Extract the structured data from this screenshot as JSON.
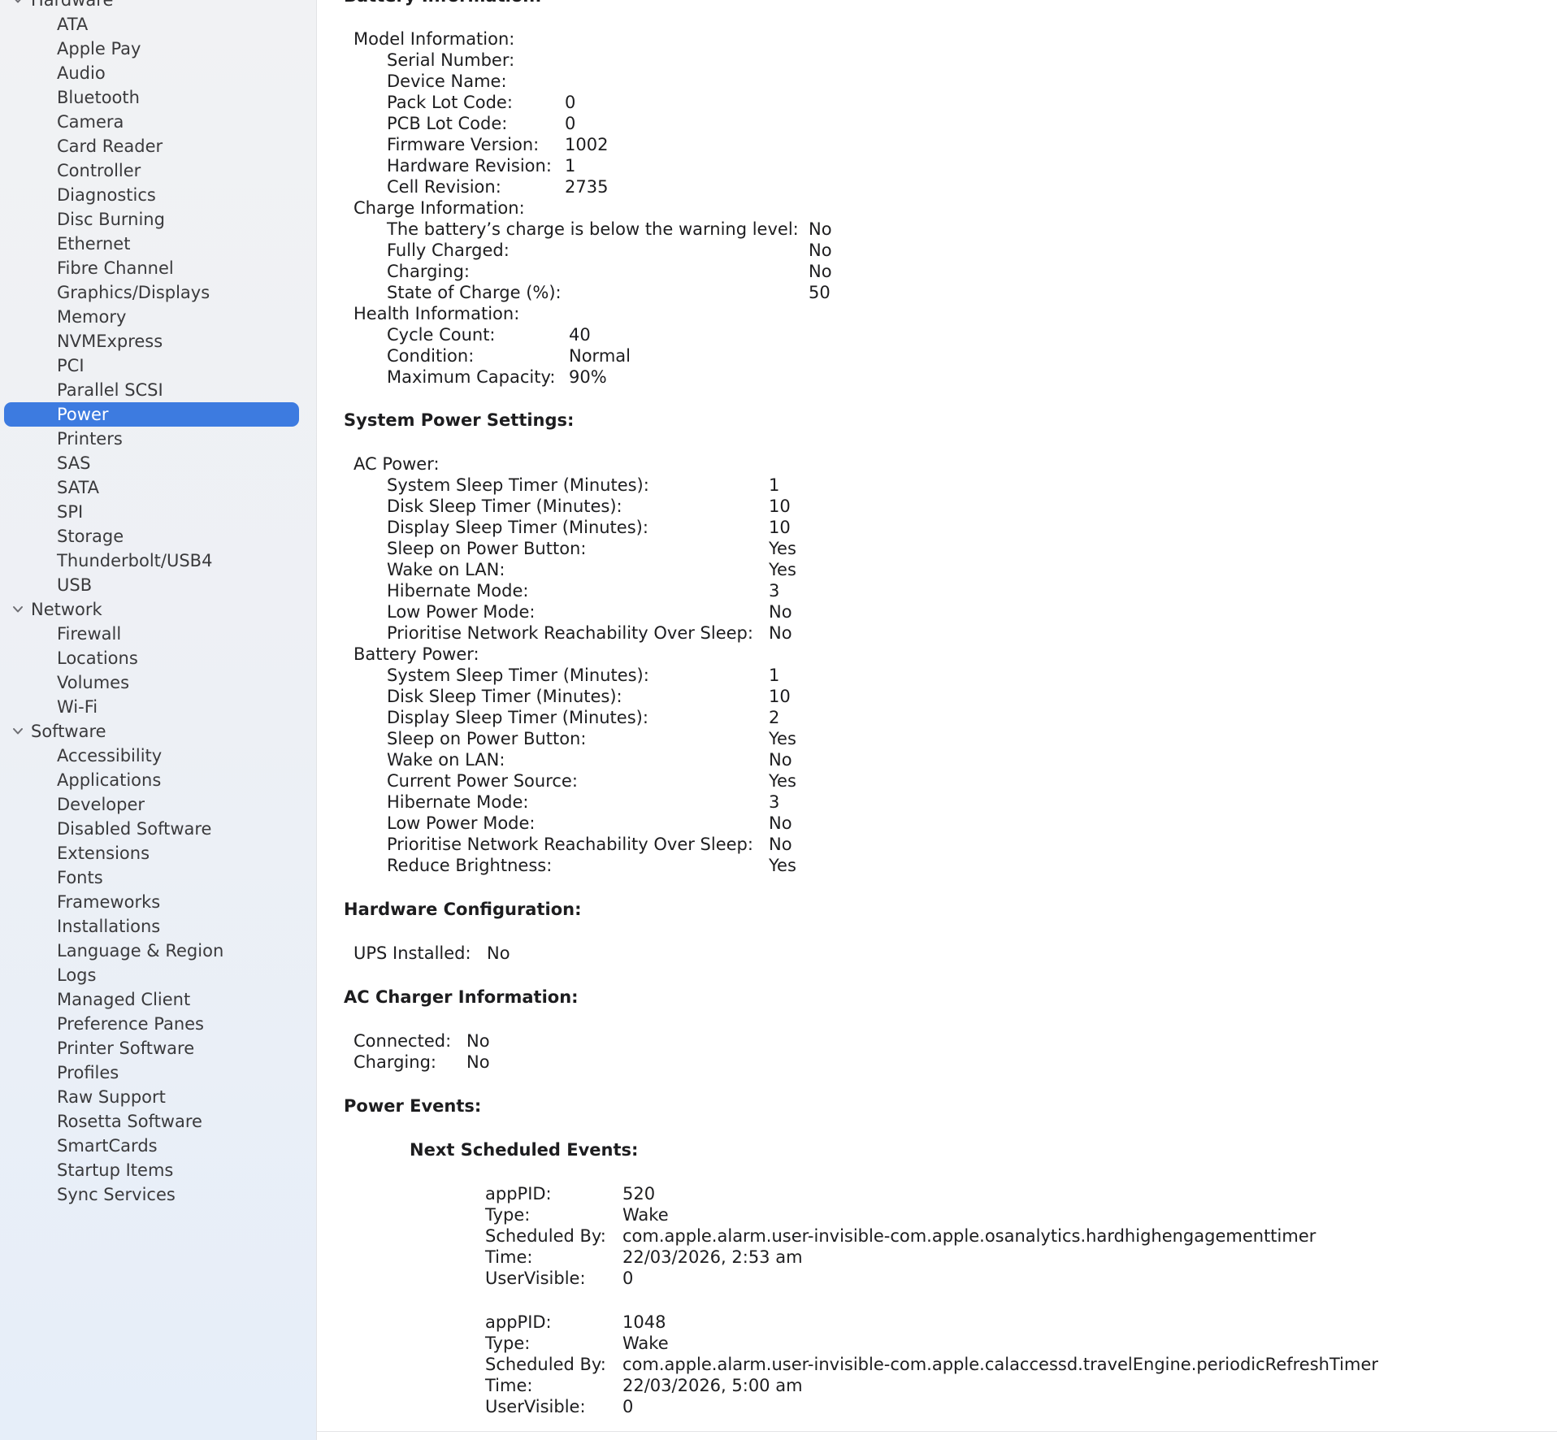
{
  "sidebar": {
    "groups": [
      {
        "label": "Hardware",
        "items": [
          "ATA",
          "Apple Pay",
          "Audio",
          "Bluetooth",
          "Camera",
          "Card Reader",
          "Controller",
          "Diagnostics",
          "Disc Burning",
          "Ethernet",
          "Fibre Channel",
          "Graphics/Displays",
          "Memory",
          "NVMExpress",
          "PCI",
          "Parallel SCSI",
          "Power",
          "Printers",
          "SAS",
          "SATA",
          "SPI",
          "Storage",
          "Thunderbolt/USB4",
          "USB"
        ]
      },
      {
        "label": "Network",
        "items": [
          "Firewall",
          "Locations",
          "Volumes",
          "Wi-Fi"
        ]
      },
      {
        "label": "Software",
        "items": [
          "Accessibility",
          "Applications",
          "Developer",
          "Disabled Software",
          "Extensions",
          "Fonts",
          "Frameworks",
          "Installations",
          "Language & Region",
          "Logs",
          "Managed Client",
          "Preference Panes",
          "Printer Software",
          "Profiles",
          "Raw Support",
          "Rosetta Software",
          "SmartCards",
          "Startup Items",
          "Sync Services"
        ]
      }
    ],
    "selected": "Power"
  },
  "content": {
    "battery_heading": "Battery Information:",
    "model_info_label": "Model Information:",
    "model_info": [
      {
        "label": "Serial Number:",
        "value": ""
      },
      {
        "label": "Device Name:",
        "value": ""
      },
      {
        "label": "Pack Lot Code:",
        "value": "0"
      },
      {
        "label": "PCB Lot Code:",
        "value": "0"
      },
      {
        "label": "Firmware Version:",
        "value": "1002"
      },
      {
        "label": "Hardware Revision:",
        "value": "1"
      },
      {
        "label": "Cell Revision:",
        "value": "2735"
      }
    ],
    "charge_info_label": "Charge Information:",
    "charge_info": [
      {
        "label": "The battery’s charge is below the warning level:",
        "value": "No"
      },
      {
        "label": "Fully Charged:",
        "value": "No"
      },
      {
        "label": "Charging:",
        "value": "No"
      },
      {
        "label": "State of Charge (%):",
        "value": "50"
      }
    ],
    "health_info_label": "Health Information:",
    "health_info": [
      {
        "label": "Cycle Count:",
        "value": "40"
      },
      {
        "label": "Condition:",
        "value": "Normal"
      },
      {
        "label": "Maximum Capacity:",
        "value": "90%"
      }
    ],
    "power_settings_heading": "System Power Settings:",
    "ac_power_label": "AC Power:",
    "ac_power": [
      {
        "label": "System Sleep Timer (Minutes):",
        "value": "1"
      },
      {
        "label": "Disk Sleep Timer (Minutes):",
        "value": "10"
      },
      {
        "label": "Display Sleep Timer (Minutes):",
        "value": "10"
      },
      {
        "label": "Sleep on Power Button:",
        "value": "Yes"
      },
      {
        "label": "Wake on LAN:",
        "value": "Yes"
      },
      {
        "label": "Hibernate Mode:",
        "value": "3"
      },
      {
        "label": "Low Power Mode:",
        "value": "No"
      },
      {
        "label": "Prioritise Network Reachability Over Sleep:",
        "value": "No"
      }
    ],
    "battery_power_label": "Battery Power:",
    "battery_power": [
      {
        "label": "System Sleep Timer (Minutes):",
        "value": "1"
      },
      {
        "label": "Disk Sleep Timer (Minutes):",
        "value": "10"
      },
      {
        "label": "Display Sleep Timer (Minutes):",
        "value": "2"
      },
      {
        "label": "Sleep on Power Button:",
        "value": "Yes"
      },
      {
        "label": "Wake on LAN:",
        "value": "No"
      },
      {
        "label": "Current Power Source:",
        "value": "Yes"
      },
      {
        "label": "Hibernate Mode:",
        "value": "3"
      },
      {
        "label": "Low Power Mode:",
        "value": "No"
      },
      {
        "label": "Prioritise Network Reachability Over Sleep:",
        "value": "No"
      },
      {
        "label": "Reduce Brightness:",
        "value": "Yes"
      }
    ],
    "hw_config_heading": "Hardware Configuration:",
    "hw_config": [
      {
        "label": "UPS Installed:",
        "value": "No"
      }
    ],
    "ac_charger_heading": "AC Charger Information:",
    "ac_charger": [
      {
        "label": "Connected:",
        "value": "No"
      },
      {
        "label": "Charging:",
        "value": "No"
      }
    ],
    "power_events_heading": "Power Events:",
    "next_events_heading": "Next Scheduled Events:",
    "events": [
      [
        {
          "label": "appPID:",
          "value": "520"
        },
        {
          "label": "Type:",
          "value": "Wake"
        },
        {
          "label": "Scheduled By:",
          "value": "com.apple.alarm.user-invisible-com.apple.osanalytics.hardhighengagementtimer"
        },
        {
          "label": "Time:",
          "value": "22/03/2026, 2:53 am"
        },
        {
          "label": "UserVisible:",
          "value": "0"
        }
      ],
      [
        {
          "label": "appPID:",
          "value": "1048"
        },
        {
          "label": "Type:",
          "value": "Wake"
        },
        {
          "label": "Scheduled By:",
          "value": "com.apple.alarm.user-invisible-com.apple.calaccessd.travelEngine.periodicRefreshTimer"
        },
        {
          "label": "Time:",
          "value": "22/03/2026, 5:00 am"
        },
        {
          "label": "UserVisible:",
          "value": "0"
        }
      ]
    ]
  },
  "colors": {
    "selection": "#3d7be0",
    "sidebar_bg": "#eef0f4",
    "text": "#1d1d1f"
  }
}
